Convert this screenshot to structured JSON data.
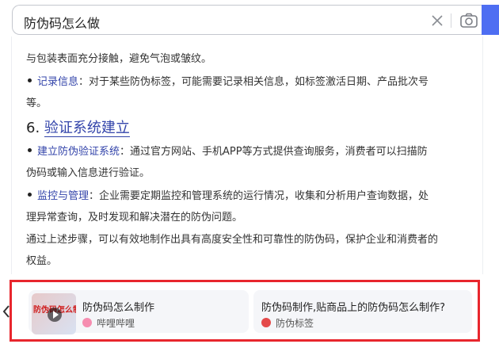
{
  "search": {
    "query": "防伪码怎么做"
  },
  "article": {
    "line0": "与包装表面充分接触，避免气泡或皱纹。",
    "item_record_label": "记录信息",
    "item_record_text": "：对于某些防伪标签，可能需要记录相关信息，如标签激活日期、产品批次号",
    "item_record_cont": "等。",
    "section6_num": "6. ",
    "section6_title": "验证系统建立",
    "item_build_label": "建立防伪验证系统",
    "item_build_text": "：通过官方网站、手机APP等方式提供查询服务，消费者可以扫描防",
    "item_build_cont": "伪码或输入信息进行验证。",
    "item_monitor_label": "监控与管理",
    "item_monitor_text": "：企业需要定期监控和管理系统的运行情况，收集和分析用户查询数据，处",
    "item_monitor_cont": "理异常查询，及时发现和解决潜在的防伪问题。",
    "summary_line1": "通过上述步骤，可以有效地制作出具有高度安全性和可靠性的防伪码，保护企业和消费者的",
    "summary_line2": "权益。"
  },
  "related": {
    "cards": [
      {
        "title": "防伪码怎么制作",
        "source": "哔哩哔哩",
        "thumb_text": "防伪码怎么制作"
      },
      {
        "title": "防伪码制作,贴商品上的防伪码怎么制作?",
        "source": "防伪标签"
      }
    ]
  },
  "colors": {
    "accent": "#4e6ef2",
    "link": "#3344aa",
    "highlight_border": "#e8262d"
  }
}
